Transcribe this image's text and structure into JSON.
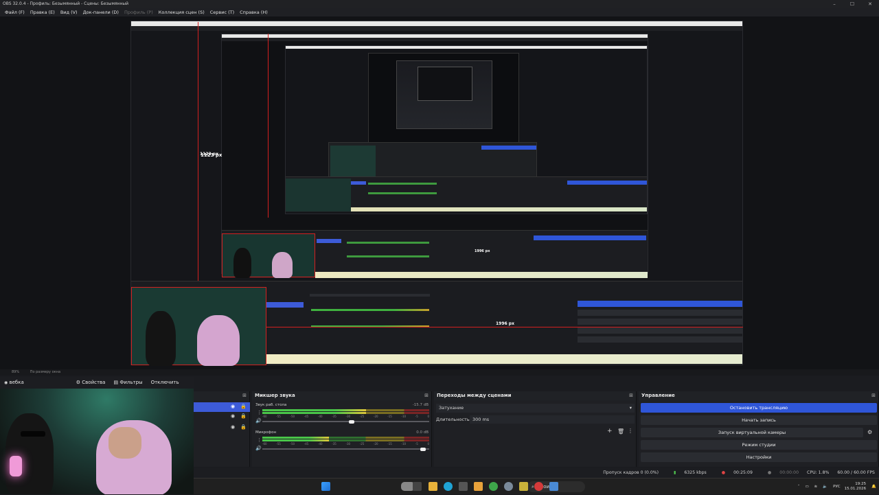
{
  "window": {
    "title": "OBS 32.0.4 - Профиль: Безымянный - Сцены: Безымянный",
    "controls": [
      "–",
      "☐",
      "✕"
    ]
  },
  "menu": {
    "items": [
      "Файл (F)",
      "Правка (E)",
      "Вид (V)",
      "Док-панели (D)",
      "Профиль (P)",
      "Коллекция сцен (S)",
      "Сервис (T)",
      "Справка (H)"
    ]
  },
  "preview": {
    "labels": {
      "height_px": "1123 px",
      "width_px": "1996 px"
    },
    "nested_labels": {
      "small_height": "1123 px",
      "small_width": "1996 px"
    }
  },
  "scale_row": {
    "zoom": "89%",
    "fit": "По размеру окна"
  },
  "source_bar": {
    "source_name": "вебка",
    "properties": "Свойства",
    "filters": "Фильтры",
    "disable": "Отключить"
  },
  "mixer": {
    "title": "Микшер звука",
    "tracks": [
      {
        "name": "Звук раб. стола",
        "db": "-15.7 dB",
        "level": 0.62,
        "volume": 0.55
      },
      {
        "name": "Микрофон",
        "db": "0.0 dB",
        "level": 0.4,
        "volume": 0.98
      }
    ],
    "ticks": [
      "-60",
      "-55",
      "-50",
      "-45",
      "-40",
      "-35",
      "-30",
      "-25",
      "-20",
      "-15",
      "-10",
      "-5",
      "0"
    ]
  },
  "transitions": {
    "title": "Переходы между сценами",
    "selected": "Затухание",
    "duration_label": "Длительность",
    "duration_value": "300 ms"
  },
  "controls": {
    "title": "Управление",
    "stop_stream": "Остановить трансляцию",
    "start_record": "Начать запись",
    "virtual_cam": "Запуск виртуальной камеры",
    "studio_mode": "Режим студии",
    "settings": "Настройки"
  },
  "status": {
    "dropped": "Пропуск кадров 0 (0.0%)",
    "bitrate": "6325 kbps",
    "stream_time": "00:25:09",
    "rec_time": "00:00:00",
    "cpu": "CPU: 1.8%",
    "fps": "60.00 / 60.00 FPS"
  },
  "taskbar": {
    "search": "Поиск",
    "lang": "РУС",
    "time": "19:25",
    "date": "15.01.2026"
  },
  "colors": {
    "accent": "#2f56d8",
    "selection_red": "#d42020"
  }
}
